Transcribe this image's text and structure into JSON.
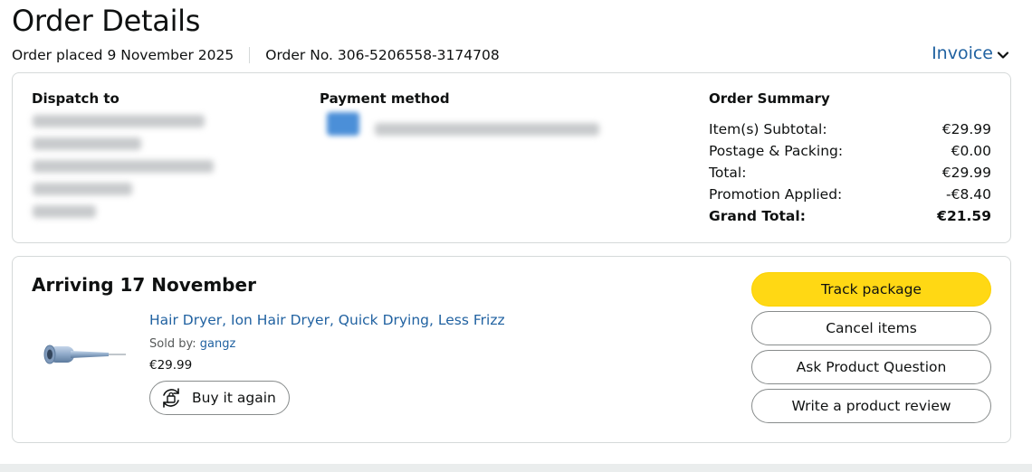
{
  "header": {
    "title": "Order Details",
    "order_placed": "Order placed 9 November 2025",
    "order_number": "Order No. 306-5206558-3174708",
    "invoice_label": "Invoice"
  },
  "shipping": {
    "heading": "Dispatch to"
  },
  "payment": {
    "heading": "Payment method"
  },
  "summary": {
    "heading": "Order Summary",
    "rows": [
      {
        "label": "Item(s) Subtotal:",
        "value": "€29.99"
      },
      {
        "label": "Postage & Packing:",
        "value": "€0.00"
      },
      {
        "label": "Total:",
        "value": "€29.99"
      },
      {
        "label": "Promotion Applied:",
        "value": "-€8.40"
      }
    ],
    "grand_total": {
      "label": "Grand Total:",
      "value": "€21.59"
    }
  },
  "shipment": {
    "arriving": "Arriving 17 November",
    "product_title": "Hair Dryer, Ion Hair Dryer, Quick Drying, Less Frizz",
    "sold_by_label": "Sold by:",
    "seller": "gangz",
    "price": "€29.99",
    "buy_again_label": "Buy it again",
    "product_image_icon": "hair-dryer-product-image"
  },
  "actions": {
    "track": "Track package",
    "cancel": "Cancel items",
    "ask": "Ask Product Question",
    "review": "Write a product review"
  },
  "colors": {
    "link": "#2162a1",
    "primary_button": "#ffd814",
    "border": "#d5d9d9",
    "text": "#0f1111"
  }
}
